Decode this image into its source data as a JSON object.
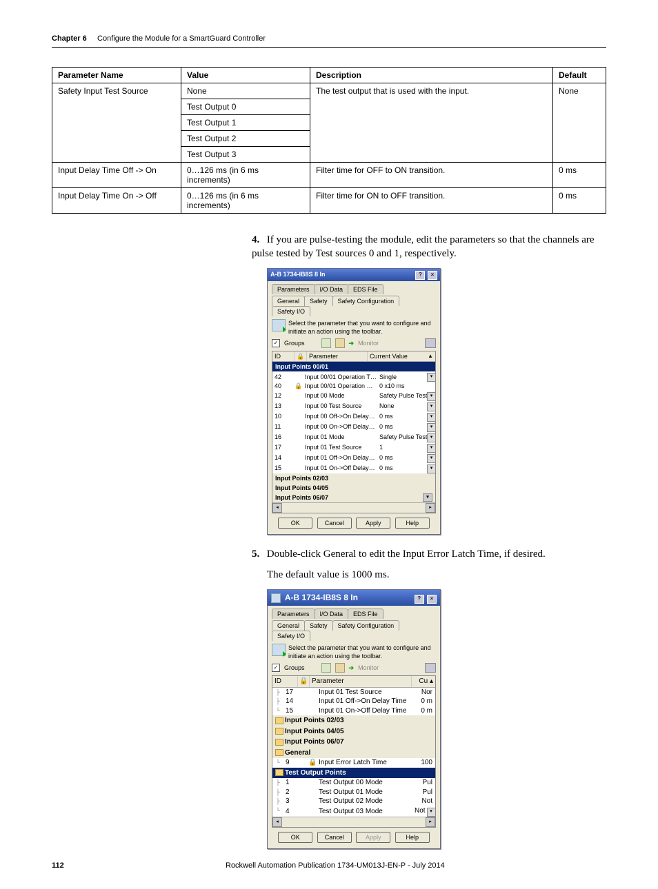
{
  "header": {
    "chapter_label": "Chapter 6",
    "chapter_title": "Configure the Module for a SmartGuard Controller"
  },
  "table": {
    "headers": [
      "Parameter Name",
      "Value",
      "Description",
      "Default"
    ],
    "rows": [
      {
        "param": "Safety Input Test Source",
        "values": [
          "None",
          "Test Output 0",
          "Test Output 1",
          "Test Output 2",
          "Test Output 3"
        ],
        "desc": "The test output that is used with the input.",
        "default": "None"
      },
      {
        "param": "Input Delay Time Off -> On",
        "values": [
          "0…126 ms (in 6 ms increments)"
        ],
        "desc": "Filter time for OFF to ON transition.",
        "default": "0 ms"
      },
      {
        "param": "Input Delay Time On -> Off",
        "values": [
          "0…126 ms (in 6 ms increments)"
        ],
        "desc": "Filter time for ON to OFF transition.",
        "default": "0 ms"
      }
    ]
  },
  "steps": {
    "s4_num": "4.",
    "s4_text": "If you are pulse-testing the module, edit the parameters so that the channels are pulse tested by Test sources 0 and 1, respectively.",
    "s5_num": "5.",
    "s5_text": "Double-click General to edit the Input Error Latch Time, if desired.",
    "s5_sub": "The default value is 1000 ms."
  },
  "dialog1": {
    "title": "A-B 1734-IB8S 8 In",
    "tabs_back": [
      "Parameters",
      "I/O Data",
      "EDS File"
    ],
    "tabs_front": [
      "General",
      "Safety",
      "Safety Configuration",
      "Safety I/O"
    ],
    "instruction": "Select the parameter that you want to configure and initiate an action using the toolbar.",
    "groups_label": "Groups",
    "monitor_label": "Monitor",
    "col_id": "ID",
    "col_param": "Parameter",
    "col_value": "Current Value",
    "group0": "Input Points 00/01",
    "rows": [
      {
        "id": "42",
        "lock": "",
        "p": "Input 00/01 Operation T…",
        "v": "Single",
        "dd": true
      },
      {
        "id": "40",
        "lock": "🔒",
        "p": "Input 00/01 Operation …",
        "v": "0 x10 ms",
        "dd": false
      },
      {
        "id": "12",
        "lock": "",
        "p": "Input 00 Mode",
        "v": "Safety Pulse Test",
        "dd": true
      },
      {
        "id": "13",
        "lock": "",
        "p": "Input 00 Test Source",
        "v": "None",
        "dd": true
      },
      {
        "id": "10",
        "lock": "",
        "p": "Input 00 Off->On Delay…",
        "v": "0 ms",
        "dd": true
      },
      {
        "id": "11",
        "lock": "",
        "p": "Input 00 On->Off Delay…",
        "v": "0 ms",
        "dd": true
      },
      {
        "id": "16",
        "lock": "",
        "p": "Input 01 Mode",
        "v": "Safety Pulse Test",
        "dd": true
      },
      {
        "id": "17",
        "lock": "",
        "p": "Input 01 Test Source",
        "v": "1",
        "dd": true
      },
      {
        "id": "14",
        "lock": "",
        "p": "Input 01 Off->On Delay…",
        "v": "0 ms",
        "dd": true
      },
      {
        "id": "15",
        "lock": "",
        "p": "Input 01 On->Off Delay…",
        "v": "0 ms",
        "dd": true
      }
    ],
    "group1": "Input Points 02/03",
    "group2": "Input Points 04/05",
    "group3": "Input Points 06/07",
    "buttons": {
      "ok": "OK",
      "cancel": "Cancel",
      "apply": "Apply",
      "help": "Help"
    }
  },
  "dialog2": {
    "title": "A-B 1734-IB8S 8 In",
    "tabs_back": [
      "Parameters",
      "I/O Data",
      "EDS File"
    ],
    "tabs_front": [
      "General",
      "Safety",
      "Safety Configuration",
      "Safety I/O"
    ],
    "instruction": "Select the parameter that you want to configure and initiate an action using the toolbar.",
    "groups_label": "Groups",
    "monitor_label": "Monitor",
    "col_id": "ID",
    "col_param": "Parameter",
    "col_value": "Cu",
    "rows_top": [
      {
        "id": "17",
        "p": "Input 01 Test Source",
        "v": "Nor"
      },
      {
        "id": "14",
        "p": "Input 01 Off->On Delay Time",
        "v": "0 m"
      },
      {
        "id": "15",
        "p": "Input 01 On->Off Delay Time",
        "v": "0 m"
      }
    ],
    "grp_ip23": "Input Points 02/03",
    "grp_ip45": "Input Points 04/05",
    "grp_ip67": "Input Points 06/07",
    "grp_general": "General",
    "row_latch": {
      "id": "9",
      "lock": "🔒",
      "p": "Input Error Latch Time",
      "v": "100"
    },
    "grp_test": "Test Output Points",
    "rows_test": [
      {
        "id": "1",
        "p": "Test Output 00 Mode",
        "v": "Pul"
      },
      {
        "id": "2",
        "p": "Test Output 01 Mode",
        "v": "Pul"
      },
      {
        "id": "3",
        "p": "Test Output 02 Mode",
        "v": "Not"
      },
      {
        "id": "4",
        "p": "Test Output 03 Mode",
        "v": "Not"
      }
    ],
    "buttons": {
      "ok": "OK",
      "cancel": "Cancel",
      "apply": "Apply",
      "help": "Help"
    }
  },
  "footer": {
    "page": "112",
    "pub": "Rockwell Automation Publication 1734-UM013J-EN-P - July 2014"
  }
}
